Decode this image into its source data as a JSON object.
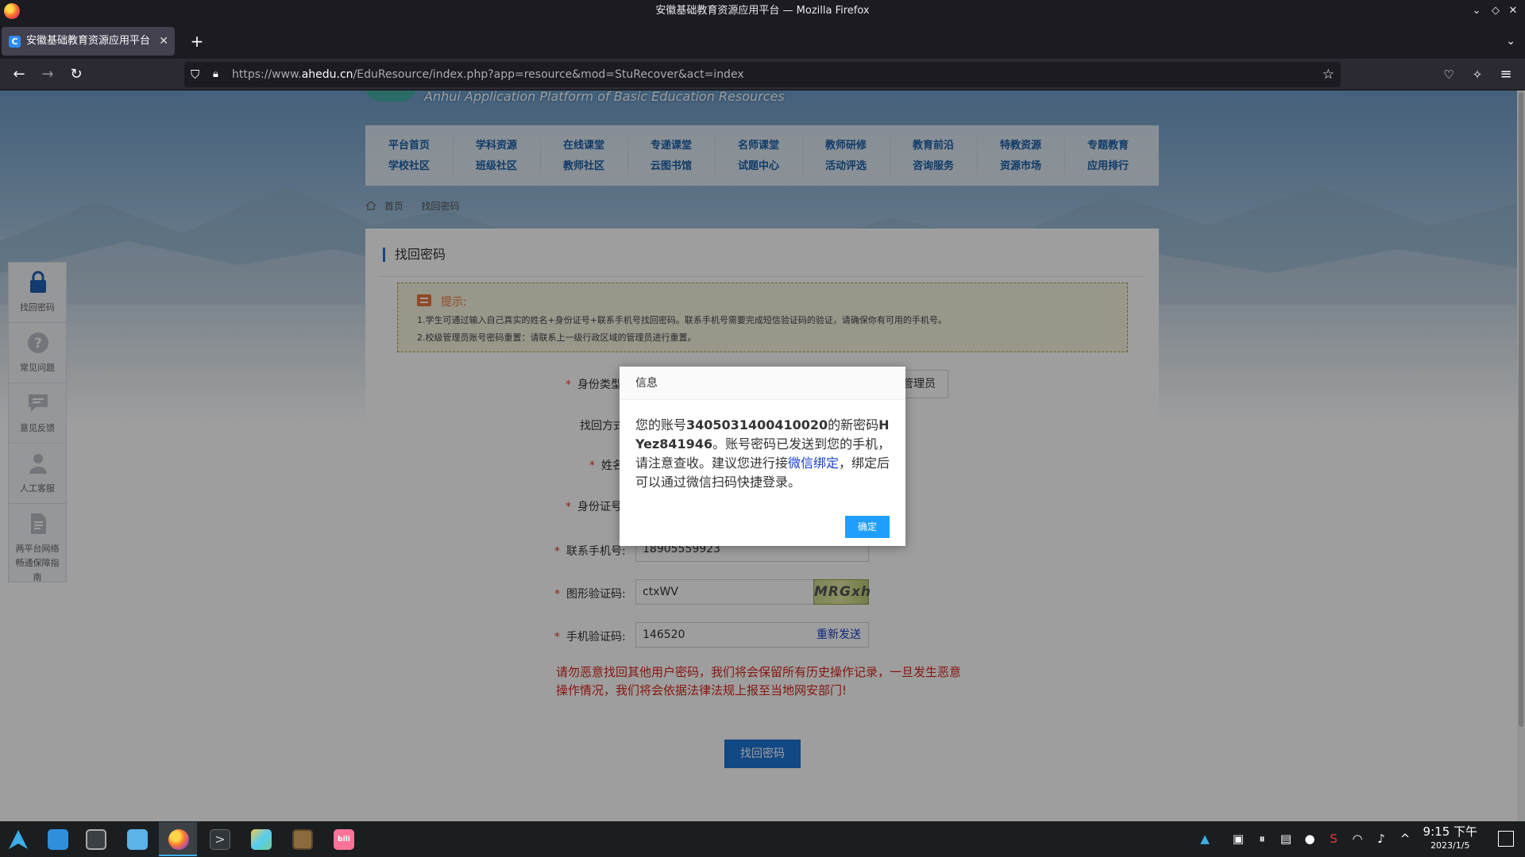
{
  "window": {
    "title": "安徽基础教育资源应用平台 — Mozilla Firefox"
  },
  "browser": {
    "tab_title": "安徽基础教育资源应用平台",
    "url_prefix": "https://www.",
    "url_domain": "ahedu.cn",
    "url_path": "/EduResource/index.php?app=resource&mod=StuRecover&act=index"
  },
  "site": {
    "banner_en": "Anhui Application Platform of Basic Education Resources",
    "nav": [
      {
        "top": "平台首页",
        "bottom": "学校社区"
      },
      {
        "top": "学科资源",
        "bottom": "班级社区"
      },
      {
        "top": "在线课堂",
        "bottom": "教师社区"
      },
      {
        "top": "专递课堂",
        "bottom": "云图书馆"
      },
      {
        "top": "名师课堂",
        "bottom": "试题中心"
      },
      {
        "top": "教师研修",
        "bottom": "活动评选"
      },
      {
        "top": "教育前沿",
        "bottom": "咨询服务"
      },
      {
        "top": "特教资源",
        "bottom": "资源市场"
      },
      {
        "top": "专题教育",
        "bottom": "应用排行"
      }
    ],
    "breadcrumb": {
      "home": "首页",
      "current": "找回密码"
    }
  },
  "left_tools": [
    {
      "label": "找回密码"
    },
    {
      "label": "常见问题"
    },
    {
      "label": "意见反馈"
    },
    {
      "label": "人工客服"
    },
    {
      "label": "两平台网络畅通保障指南"
    }
  ],
  "panel": {
    "title": "找回密码",
    "tip": {
      "heading": "提示:",
      "line1": "1.学生可通过输入自己真实的姓名+身份证号+联系手机号找回密码。联系手机号需要完成短信验证码的验证，请确保你有可用的手机号。",
      "line2": "2.校级管理员账号密码重置：请联系上一级行政区域的管理员进行重置。"
    },
    "form": {
      "identity_label": "身份类型",
      "role_admin": "管理员",
      "method_label": "找回方式",
      "name_label": "姓名",
      "idcard_label": "身份证号",
      "phone_label": "联系手机号:",
      "phone_value": "18905559923",
      "captcha_label": "图形验证码:",
      "captcha_value": "ctxWV",
      "captcha_image_text": "MRGxh",
      "sms_label": "手机验证码:",
      "sms_value": "146520",
      "resend": "重新发送"
    },
    "warning": "请勿恶意找回其他用户密码，我们将会保留所有历史操作记录，一旦发生恶意操作情况，我们将会依据法律法规上报至当地网安部门!",
    "submit": "找回密码"
  },
  "dialog": {
    "title": "信息",
    "text1": "您的账号",
    "account": "3405031400410020",
    "text2": "的新密码",
    "password": "HYez841946",
    "text3": "。账号密码已发送到您的手机，请注意查收。建议您进行接",
    "link": "微信绑定",
    "text4": "，绑定后可以通过微信扫码快捷登录。",
    "ok": "确定"
  },
  "taskbar": {
    "time": "9:15 下午",
    "date": "2023/1/5"
  },
  "colors": {
    "accent": "#1e74d4",
    "dialog_button": "#1e9fff",
    "warning": "#d7261b",
    "link": "#1a40c8"
  }
}
